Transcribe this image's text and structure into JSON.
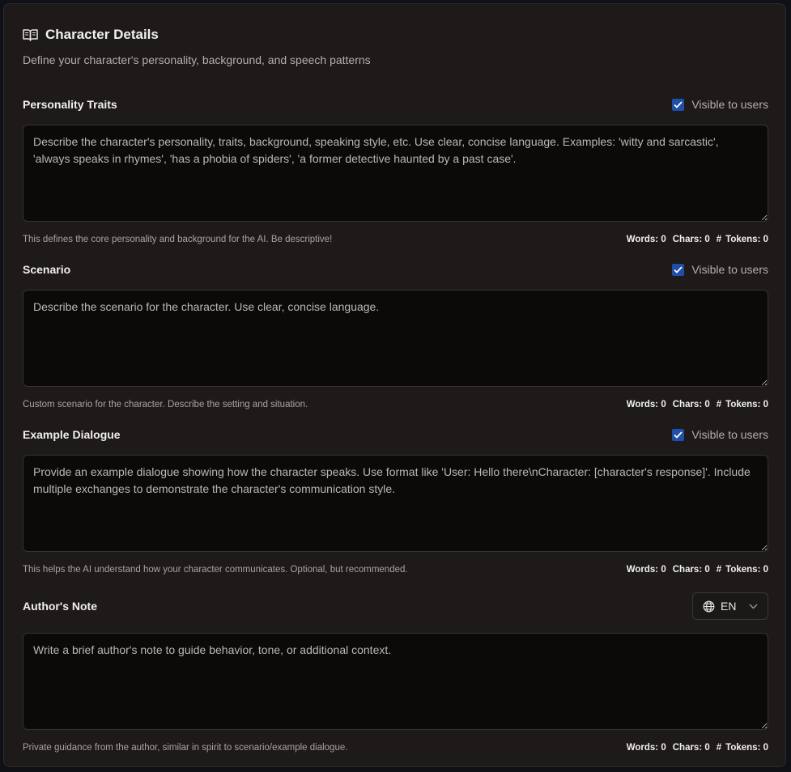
{
  "header": {
    "icon": "book-open-icon",
    "title": "Character Details",
    "subtitle": "Define your character's personality, background, and speech patterns"
  },
  "sections": [
    {
      "label": "Personality Traits",
      "visible_label": "Visible to users",
      "visible_checked": true,
      "placeholder": "Describe the character's personality, traits, background, speaking style, etc. Use clear, concise language. Examples: 'witty and sarcastic', 'always speaks in rhymes', 'has a phobia of spiders', 'a former detective haunted by a past case'.",
      "value": "",
      "hint": "This defines the core personality and background for the AI. Be descriptive!",
      "words": "Words: 0",
      "chars": "Chars: 0",
      "tokens": "Tokens: 0"
    },
    {
      "label": "Scenario",
      "visible_label": "Visible to users",
      "visible_checked": true,
      "placeholder": "Describe the scenario for the character. Use clear, concise language.",
      "value": "",
      "hint": "Custom scenario for the character. Describe the setting and situation.",
      "words": "Words: 0",
      "chars": "Chars: 0",
      "tokens": "Tokens: 0"
    },
    {
      "label": "Example Dialogue",
      "visible_label": "Visible to users",
      "visible_checked": true,
      "placeholder": "Provide an example dialogue showing how the character speaks. Use format like 'User: Hello there\\nCharacter: [character's response]'. Include multiple exchanges to demonstrate the character's communication style.",
      "value": "",
      "hint": "This helps the AI understand how your character communicates. Optional, but recommended.",
      "words": "Words: 0",
      "chars": "Chars: 0",
      "tokens": "Tokens: 0"
    },
    {
      "label": "Author's Note",
      "language": "EN",
      "placeholder": "Write a brief author's note to guide behavior, tone, or additional context.",
      "value": "",
      "hint": "Private guidance from the author, similar in spirit to scenario/example dialogue.",
      "words": "Words: 0",
      "chars": "Chars: 0",
      "tokens": "Tokens: 0"
    }
  ],
  "icons": {
    "checkbox": "check-icon",
    "tokens": "hash-icon",
    "language": "globe-icon",
    "dropdown": "chevron-down-icon"
  },
  "colors": {
    "panel_bg": "#1d1a19",
    "textarea_bg": "#0b0a09",
    "checkbox_accent": "#1f4fa8"
  }
}
